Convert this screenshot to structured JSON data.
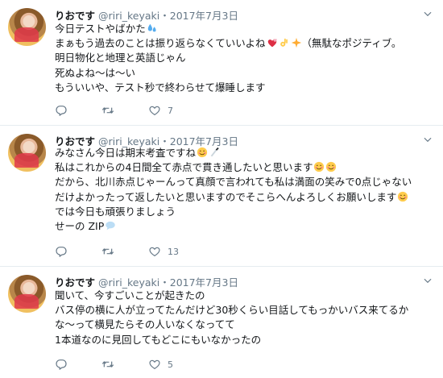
{
  "tweets": [
    {
      "name": "りおです",
      "handle": "@riri_keyaki",
      "separator": "・",
      "date": "2017年7月3日",
      "lines": [
        "今日テストやばかた",
        "まぁもう過去のことは振り返らなくていいよね",
        "明日物化と地理と英語じゃん",
        "死ぬよね～は～い",
        "もういいや、テスト秒で終わらせて爆睡します"
      ],
      "line2_suffix": "（無駄なポジティブ。",
      "reply_count": "",
      "retweet_count": "",
      "like_count": "7"
    },
    {
      "name": "りおです",
      "handle": "@riri_keyaki",
      "separator": "・",
      "date": "2017年7月3日",
      "lines": [
        "みなさん今日は期末考査ですね",
        "私はこれからの4日間全て赤点で貫き通したいと思います",
        "だから、北川赤点じゃーんって真顔で言われても私は満面の笑みで0点じゃない",
        "だけよかったって返したいと思いますのでそこらへんよろしくお願いします",
        "では今日も頑張りましょう",
        "せーの ZIP"
      ],
      "reply_count": "",
      "retweet_count": "",
      "like_count": "13"
    },
    {
      "name": "りおです",
      "handle": "@riri_keyaki",
      "separator": "・",
      "date": "2017年7月3日",
      "lines": [
        "聞いて、今すごいことが起きたの",
        "バス停の横に人が立ってたんだけど30秒くらい目話してもっかいバス来てるか",
        "な～って横見たらその人いなくなってて",
        "1本道なのに見回してもどこにもいなかったの"
      ],
      "reply_count": "",
      "retweet_count": "",
      "like_count": "5"
    }
  ],
  "icons": {
    "reply": "reply-icon",
    "retweet": "retweet-icon",
    "like": "heart-icon",
    "caret": "chevron-down-icon",
    "emoji": [
      "sweat-droplets-icon",
      "two-hearts-icon",
      "ok-hand-icon",
      "sparkles-icon",
      "smiling-face-icon",
      "knife-icon",
      "speech-balloon-icon"
    ]
  },
  "colors": {
    "name": "#14171a",
    "meta": "#657786",
    "separator": "#e6ecf0"
  }
}
